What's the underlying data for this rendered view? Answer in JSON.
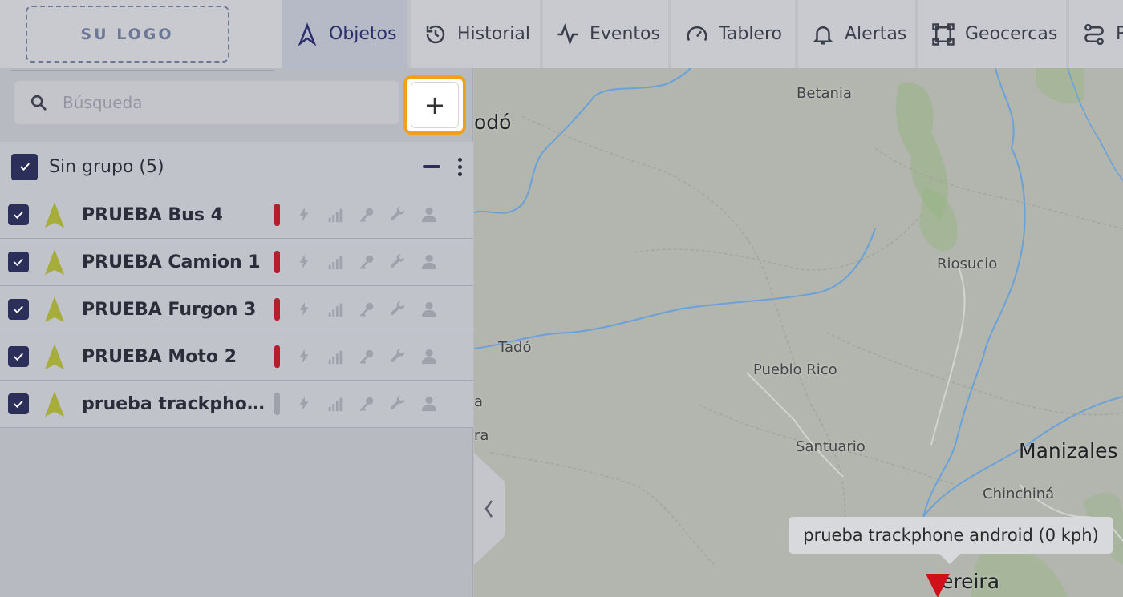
{
  "logo": {
    "text": "SU LOGO"
  },
  "nav": {
    "tabs": [
      {
        "label": "Objetos",
        "icon": "navigation-arrow-icon",
        "active": true
      },
      {
        "label": "Historial",
        "icon": "history-icon"
      },
      {
        "label": "Eventos",
        "icon": "activity-pulse-icon"
      },
      {
        "label": "Tablero",
        "icon": "gauge-icon"
      },
      {
        "label": "Alertas",
        "icon": "bell-icon"
      },
      {
        "label": "Geocercas",
        "icon": "geofence-square-icon"
      },
      {
        "label": "R",
        "icon": "route-icon"
      }
    ]
  },
  "sidebar": {
    "search_placeholder": "Búsqueda",
    "add_label": "+",
    "group": {
      "title": "Sin grupo (5)"
    },
    "objects": [
      {
        "name": "PRUEBA Bus 4",
        "status_color": "#b3202a"
      },
      {
        "name": "PRUEBA Camion 1",
        "status_color": "#b3202a"
      },
      {
        "name": "PRUEBA Furgon 3",
        "status_color": "#b3202a"
      },
      {
        "name": "PRUEBA Moto 2",
        "status_color": "#b3202a"
      },
      {
        "name": "prueba trackphon...",
        "status_color": "#9ea1a9"
      }
    ]
  },
  "map": {
    "places": [
      "Betania",
      "odó",
      "Riosucio",
      "Tadó",
      "Pueblo Rico",
      "Santuario",
      "Manizales",
      "Chinchiná",
      "a",
      "ra",
      "ereira"
    ],
    "tooltip": "prueba trackphone android (0 kph)",
    "colors": {
      "water": "#6aa1d8",
      "forest": "#98b486",
      "border": "#9a9d94"
    }
  }
}
